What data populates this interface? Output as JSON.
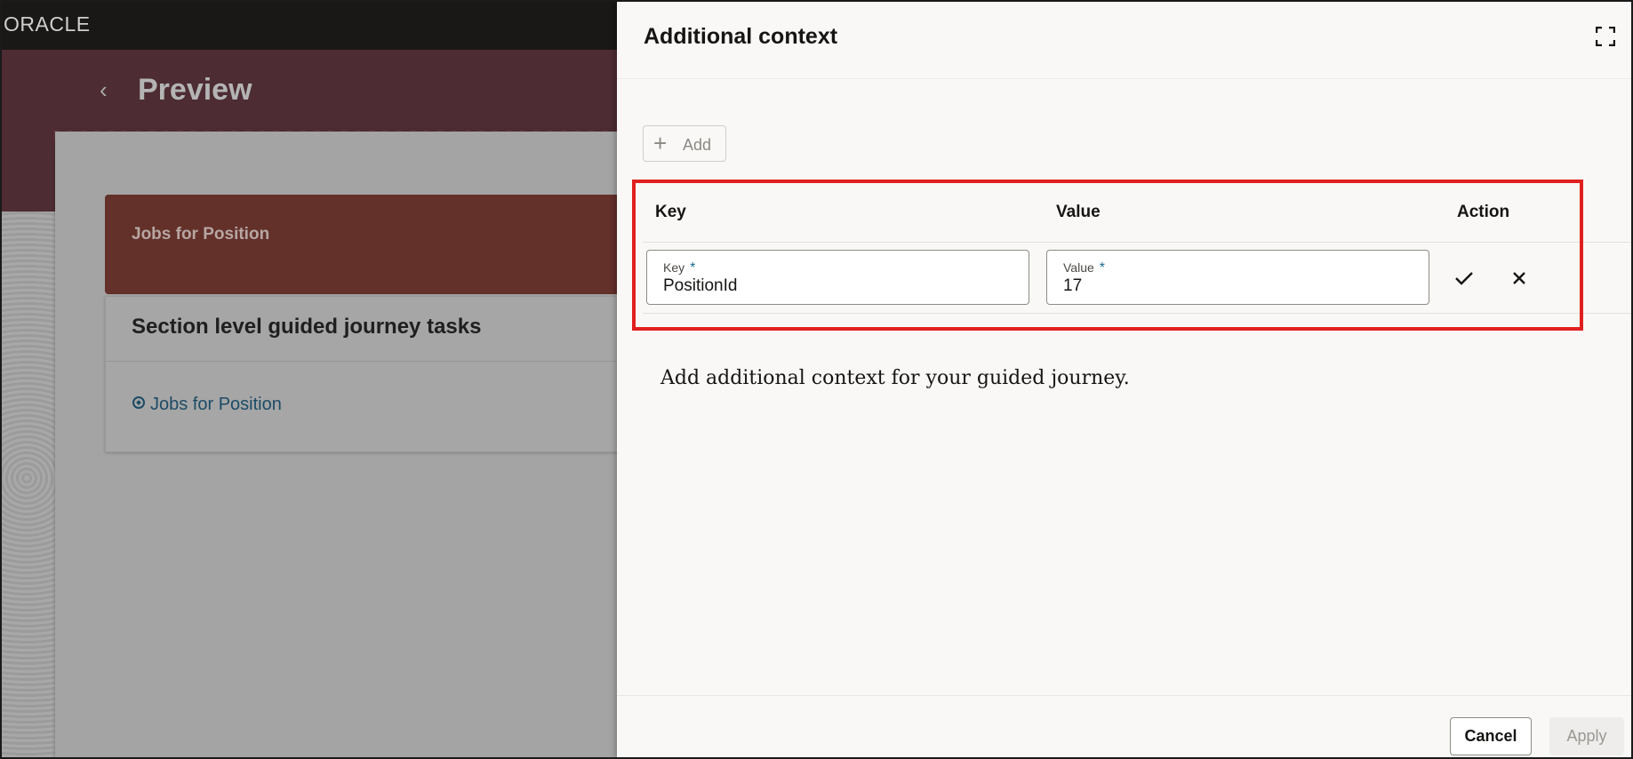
{
  "app": {
    "logo": "ORACLE",
    "page_title": "Preview",
    "jobs_banner": "Jobs for Position",
    "section_title": "Section level guided journey tasks",
    "section_link": "Jobs for Position"
  },
  "drawer": {
    "title": "Additional context",
    "add_label": "Add",
    "table": {
      "columns": [
        "Key",
        "Value",
        "Action"
      ],
      "row": {
        "key_label": "Key",
        "key_required": "*",
        "key_value": "PositionId",
        "value_label": "Value",
        "value_required": "*",
        "value_value": "17"
      }
    },
    "help_text": "Add additional context for your guided journey.",
    "cancel_label": "Cancel",
    "apply_label": "Apply"
  },
  "colors": {
    "highlight": "#e0201f",
    "banner": "#63302a",
    "hero": "#4d2c33",
    "link": "#1c4b66"
  },
  "icons": [
    "back-icon",
    "compass-icon",
    "expand-icon",
    "plus-icon",
    "check-icon",
    "close-icon"
  ]
}
